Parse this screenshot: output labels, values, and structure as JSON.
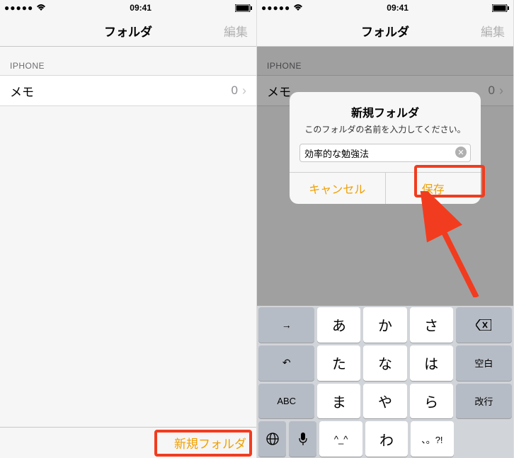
{
  "statusbar": {
    "dots": "●●●●●",
    "time": "09:41",
    "battery_icon": "battery-icon"
  },
  "screen1": {
    "title": "フォルダ",
    "edit": "編集",
    "section": "IPHONE",
    "row_label": "メモ",
    "row_count": "0",
    "new_folder": "新規フォルダ"
  },
  "screen2": {
    "title": "フォルダ",
    "edit": "編集",
    "section": "IPHONE",
    "row_label": "メモ",
    "row_count": "0",
    "alert": {
      "title": "新規フォルダ",
      "message": "このフォルダの名前を入力してください。",
      "input_value": "効率的な勉強法",
      "cancel": "キャンセル",
      "save": "保存"
    },
    "keyboard": {
      "r1": [
        "→",
        "あ",
        "か",
        "さ"
      ],
      "r2": [
        "↶",
        "た",
        "な",
        "は",
        "空白"
      ],
      "r3": [
        "ABC",
        "ま",
        "や",
        "ら",
        "改行"
      ],
      "r4": [
        "🌐",
        "🎤",
        "^_^",
        "わ",
        "、。?!"
      ]
    }
  }
}
